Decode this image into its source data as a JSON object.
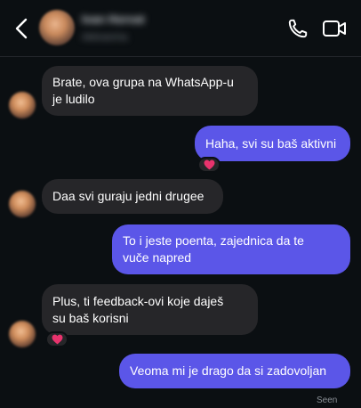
{
  "header": {
    "contact_name": "Ivan Horvat",
    "contact_status": "Aktivan/na",
    "icons": {
      "back": "chevron-left-icon",
      "call": "phone-icon",
      "video": "video-camera-icon"
    }
  },
  "messages": [
    {
      "direction": "incoming",
      "lines": [
        "Brate, ova grupa na WhatsApp-u",
        "je ludilo"
      ]
    },
    {
      "direction": "outgoing",
      "lines": [
        "Haha, svi su baš aktivni"
      ],
      "reaction": "heart"
    },
    {
      "direction": "incoming",
      "lines": [
        "Daa svi guraju jedni drugee"
      ]
    },
    {
      "direction": "outgoing",
      "lines": [
        "To i jeste poenta, zajednica da te",
        "vuče napred"
      ]
    },
    {
      "direction": "incoming",
      "lines": [
        "Plus, ti feedback-ovi koje daješ",
        "su baš korisni"
      ],
      "reaction": "heart"
    },
    {
      "direction": "outgoing",
      "lines": [
        "Veoma mi je drago da si zadovoljan"
      ]
    }
  ],
  "status": {
    "seen_label": "Seen"
  },
  "colors": {
    "background": "#0b0f12",
    "incoming_bubble": "#262629",
    "outgoing_bubble": "#5b56e8",
    "heart": "#e8336d"
  }
}
